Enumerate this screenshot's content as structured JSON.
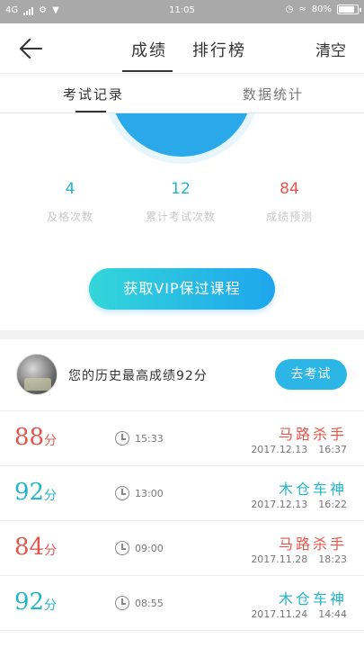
{
  "status_bar": {
    "network": "4G",
    "time": "11:05",
    "battery": "80%"
  },
  "header": {
    "tabs": [
      "成绩",
      "排行榜"
    ],
    "action": "清空"
  },
  "sub_tabs": [
    "考试记录",
    "数据统计"
  ],
  "stats": [
    {
      "value": "4",
      "label": "及格次数"
    },
    {
      "value": "12",
      "label": "累计考试次数"
    },
    {
      "value": "84",
      "label": "成绩预测"
    }
  ],
  "vip_button": "获取VIP保过课程",
  "best": {
    "text": "您的历史最高成绩92分",
    "button": "去考试"
  },
  "records": [
    {
      "score": "88",
      "unit": "分",
      "time": "15:33",
      "title": "马路杀手",
      "date": "2017.12.13",
      "clock": "16:37"
    },
    {
      "score": "92",
      "unit": "分",
      "time": "13:00",
      "title": "木仓车神",
      "date": "2017.12.13",
      "clock": "16:22"
    },
    {
      "score": "84",
      "unit": "分",
      "time": "09:00",
      "title": "马路杀手",
      "date": "2017.11.28",
      "clock": "18:23"
    },
    {
      "score": "92",
      "unit": "分",
      "time": "08:55",
      "title": "木仓车神",
      "date": "2017.11.24",
      "clock": "14:44"
    }
  ],
  "colors": {
    "teal": "#24b5c9",
    "red": "#e4564c",
    "gauge": "#29a9ea"
  }
}
